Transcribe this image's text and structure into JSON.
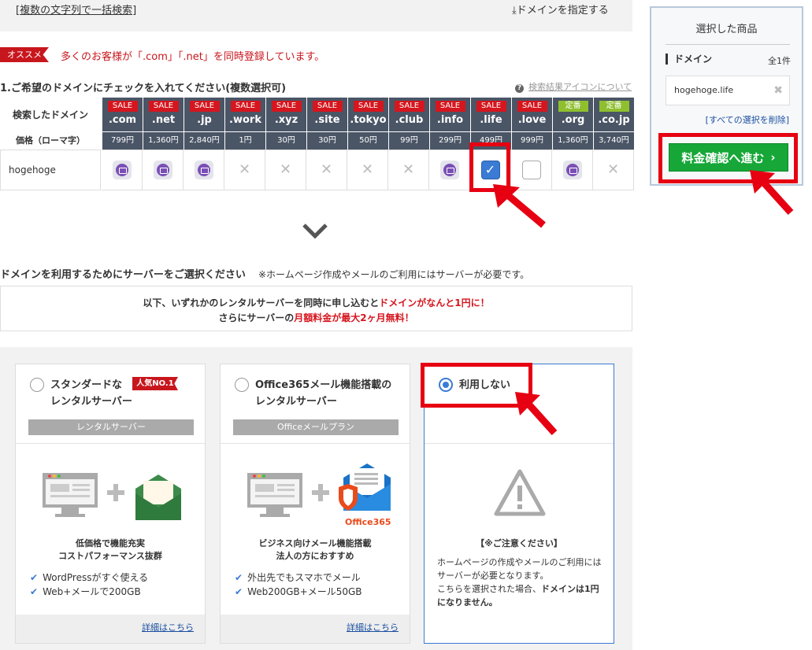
{
  "top": {
    "search_link": "[複数の文字列で一括検索]",
    "specify": "⤓ドメインを指定する"
  },
  "recommend": {
    "badge": "オススメ",
    "text": "多くのお客様が「.com」「.net」を同時登録しています。"
  },
  "section1": {
    "title": "1.ご希望のドメインにチェックを入れてください(複数選択可)",
    "help": "検索結果アイコンについて"
  },
  "table": {
    "searched_label": "検索したドメイン",
    "price_label": "価格（ローマ字）",
    "domain_name": "hogehoge",
    "columns": [
      {
        "tag": "SALE",
        "tld": ".com",
        "price": "799円",
        "status": "mail"
      },
      {
        "tag": "SALE",
        "tld": ".net",
        "price": "1,360円",
        "status": "mail"
      },
      {
        "tag": "SALE",
        "tld": ".jp",
        "price": "2,840円",
        "status": "mail"
      },
      {
        "tag": "SALE",
        "tld": ".work",
        "price": "1円",
        "status": "unavailable"
      },
      {
        "tag": "SALE",
        "tld": ".xyz",
        "price": "30円",
        "status": "unavailable"
      },
      {
        "tag": "SALE",
        "tld": ".site",
        "price": "30円",
        "status": "unavailable"
      },
      {
        "tag": "SALE",
        "tld": ".tokyo",
        "price": "50円",
        "status": "unavailable"
      },
      {
        "tag": "SALE",
        "tld": ".club",
        "price": "99円",
        "status": "unavailable"
      },
      {
        "tag": "SALE",
        "tld": ".info",
        "price": "299円",
        "status": "mail"
      },
      {
        "tag": "SALE",
        "tld": ".life",
        "price": "499円",
        "status": "checked"
      },
      {
        "tag": "SALE",
        "tld": ".love",
        "price": "999円",
        "status": "unchecked"
      },
      {
        "tag": "定番",
        "tld": ".org",
        "price": "1,360円",
        "status": "mail"
      },
      {
        "tag": "定番",
        "tld": ".co.jp",
        "price": "3,740円",
        "status": "unavailable"
      }
    ]
  },
  "server": {
    "title": "ドメインを利用するためにサーバーをご選択ください",
    "note": "※ホームページ作成やメールのご利用にはサーバーが必要です。",
    "promo_line1_a": "以下、いずれかのレンタルサーバーを同時に申し込むと",
    "promo_line1_b": "ドメインがなんと1円に！",
    "promo_line2_a": "さらにサーバーの",
    "promo_line2_b": "月額料金が最大2ヶ月無料！",
    "cards": [
      {
        "title1": "スタンダードな",
        "title2": "レンタルサーバー",
        "badge": "人気NO.1",
        "plan": "レンタルサーバー",
        "feat1": "低価格で機能充実",
        "feat2": "コストパフォーマンス抜群",
        "bullet1": "WordPressがすぐ使える",
        "bullet2": "Web+メールで200GB",
        "detail": "詳細はこちら"
      },
      {
        "title1": "Office365メール機能搭載の",
        "title2": "レンタルサーバー",
        "plan": "Officeメールプラン",
        "office_label": "Office365",
        "feat1": "ビジネス向けメール機能搭載",
        "feat2": "法人の方におすすめ",
        "bullet1": "外出先でもスマホでメール",
        "bullet2": "Web200GB+メール50GB",
        "detail": "詳細はこちら"
      },
      {
        "title1": "利用しない",
        "warn_head": "【※ご注意ください】",
        "warn1": "ホームページの作成やメールのご利用にはサーバーが必要となります。",
        "warn2a": "こちらを選択された場合、",
        "warn2b": "ドメインは1円になりません。"
      }
    ]
  },
  "panel": {
    "title": "選択した商品",
    "tag": "ドメイン",
    "count": "全1件",
    "item": "hogehoge.life",
    "clear": "[すべての選択を削除]",
    "proceed": "料金確認へ進む"
  },
  "colors": {
    "accent_red": "#e60012",
    "sale_red": "#d5161e",
    "header_dark": "#4a5566",
    "proceed_green": "#16a738",
    "select_blue": "#3a7bd5",
    "teiban_green": "#8fbf2f"
  }
}
